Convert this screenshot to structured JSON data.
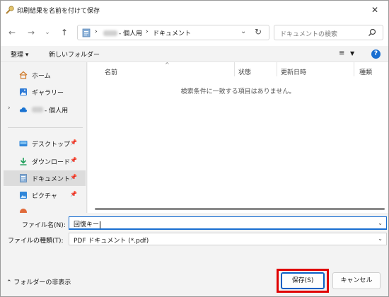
{
  "window": {
    "title": "印刷結果を名前を付けて保存"
  },
  "address": {
    "path_1": "- 個人用",
    "path_2": "ドキュメント",
    "separator": "›"
  },
  "search": {
    "placeholder": "ドキュメントの検索"
  },
  "toolbar": {
    "organize": "整理 ▾",
    "new_folder": "新しいフォルダー"
  },
  "sidebar": {
    "items": [
      {
        "label": "ホーム",
        "icon": "home-icon"
      },
      {
        "label": "ギャラリー",
        "icon": "gallery-icon"
      },
      {
        "label": "- 個人用",
        "icon": "cloud-icon"
      },
      {
        "label": "デスクトップ",
        "icon": "desktop-icon"
      },
      {
        "label": "ダウンロード",
        "icon": "download-icon"
      },
      {
        "label": "ドキュメント",
        "icon": "documents-icon"
      },
      {
        "label": "ピクチャ",
        "icon": "pictures-icon"
      }
    ]
  },
  "columns": [
    "名前",
    "状態",
    "更新日時",
    "種類"
  ],
  "empty_message": "検索条件に一致する項目はありません。",
  "form": {
    "filename_label": "ファイル名(N):",
    "filename_value": "回復キー",
    "filetype_label": "ファイルの種類(T):",
    "filetype_value": "PDF ドキュメント (*.pdf)"
  },
  "footer": {
    "hide_folders": "フォルダーの非表示",
    "save": "保存(S)",
    "cancel": "キャンセル"
  },
  "colors": {
    "accent": "#1a6fd1",
    "highlight": "#e00000"
  }
}
